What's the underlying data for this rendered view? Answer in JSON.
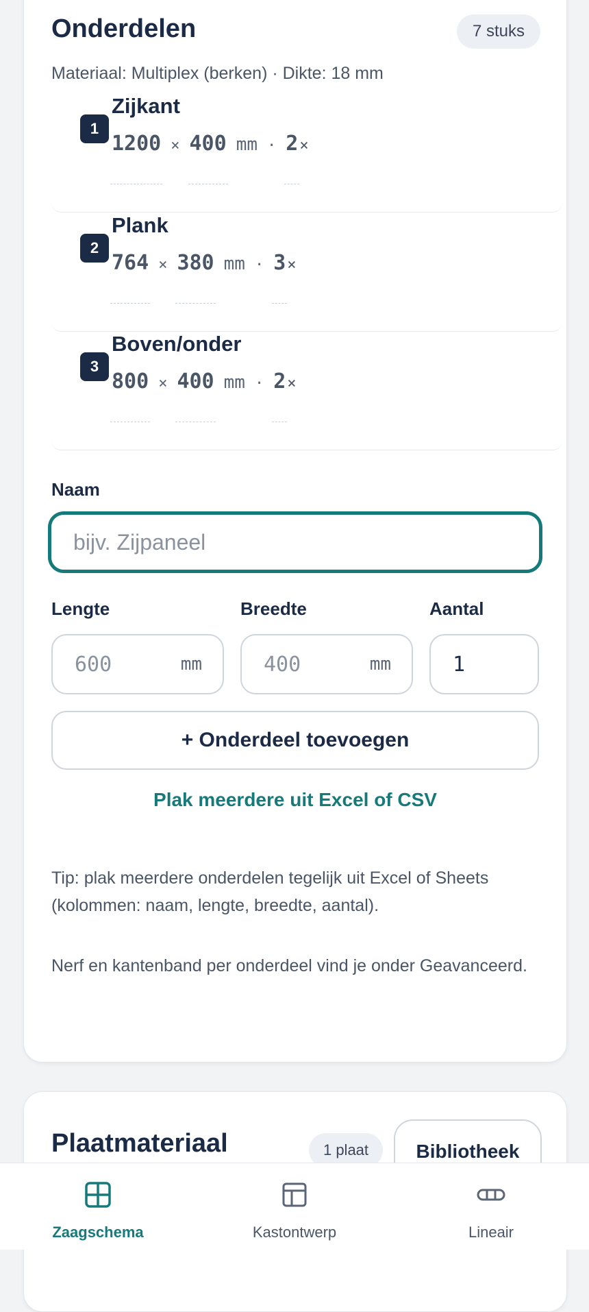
{
  "parts_card": {
    "title": "Onderdelen",
    "count_badge": "7 stuks",
    "material_info": "Materiaal: Multiplex (berken) · Dikte: 18 mm",
    "parts": [
      {
        "number": "1",
        "name": "Zijkant",
        "length": "1200",
        "width": "400",
        "unit": "mm",
        "quantity": "2"
      },
      {
        "number": "2",
        "name": "Plank",
        "length": "764",
        "width": "380",
        "unit": "mm",
        "quantity": "3"
      },
      {
        "number": "3",
        "name": "Boven/onder",
        "length": "800",
        "width": "400",
        "unit": "mm",
        "quantity": "2"
      }
    ],
    "times_symbol": "×",
    "dot_symbol": "·",
    "form": {
      "name_label": "Naam",
      "name_placeholder": "bijv. Zijpaneel",
      "length_label": "Lengte",
      "length_placeholder": "600",
      "width_label": "Breedte",
      "width_placeholder": "400",
      "unit": "mm",
      "quantity_label": "Aantal",
      "quantity_value": "1",
      "add_button": "+ Onderdeel toevoegen",
      "paste_link": "Plak meerdere uit Excel of CSV"
    },
    "tip_text": "Tip: plak meerdere onderdelen tegelijk uit Excel of Sheets (kolommen: naam, lengte, breedte, aantal).",
    "advanced_note": "Nerf en kantenband per onderdeel vind je onder Geavanceerd."
  },
  "sheet_card": {
    "title": "Plaatmateriaal",
    "count_badge": "1 plaat",
    "library_button": "Bibliotheek"
  },
  "bottom_nav": {
    "items": [
      {
        "label": "Zaagschema",
        "icon": "grid-icon",
        "active": true
      },
      {
        "label": "Kastontwerp",
        "icon": "cabinet-layout-icon",
        "active": false
      },
      {
        "label": "Lineair",
        "icon": "linear-bar-icon",
        "active": false
      }
    ]
  },
  "colors": {
    "accent": "#177a7a",
    "navy": "#1b2a45",
    "background": "#f1f3f5"
  }
}
